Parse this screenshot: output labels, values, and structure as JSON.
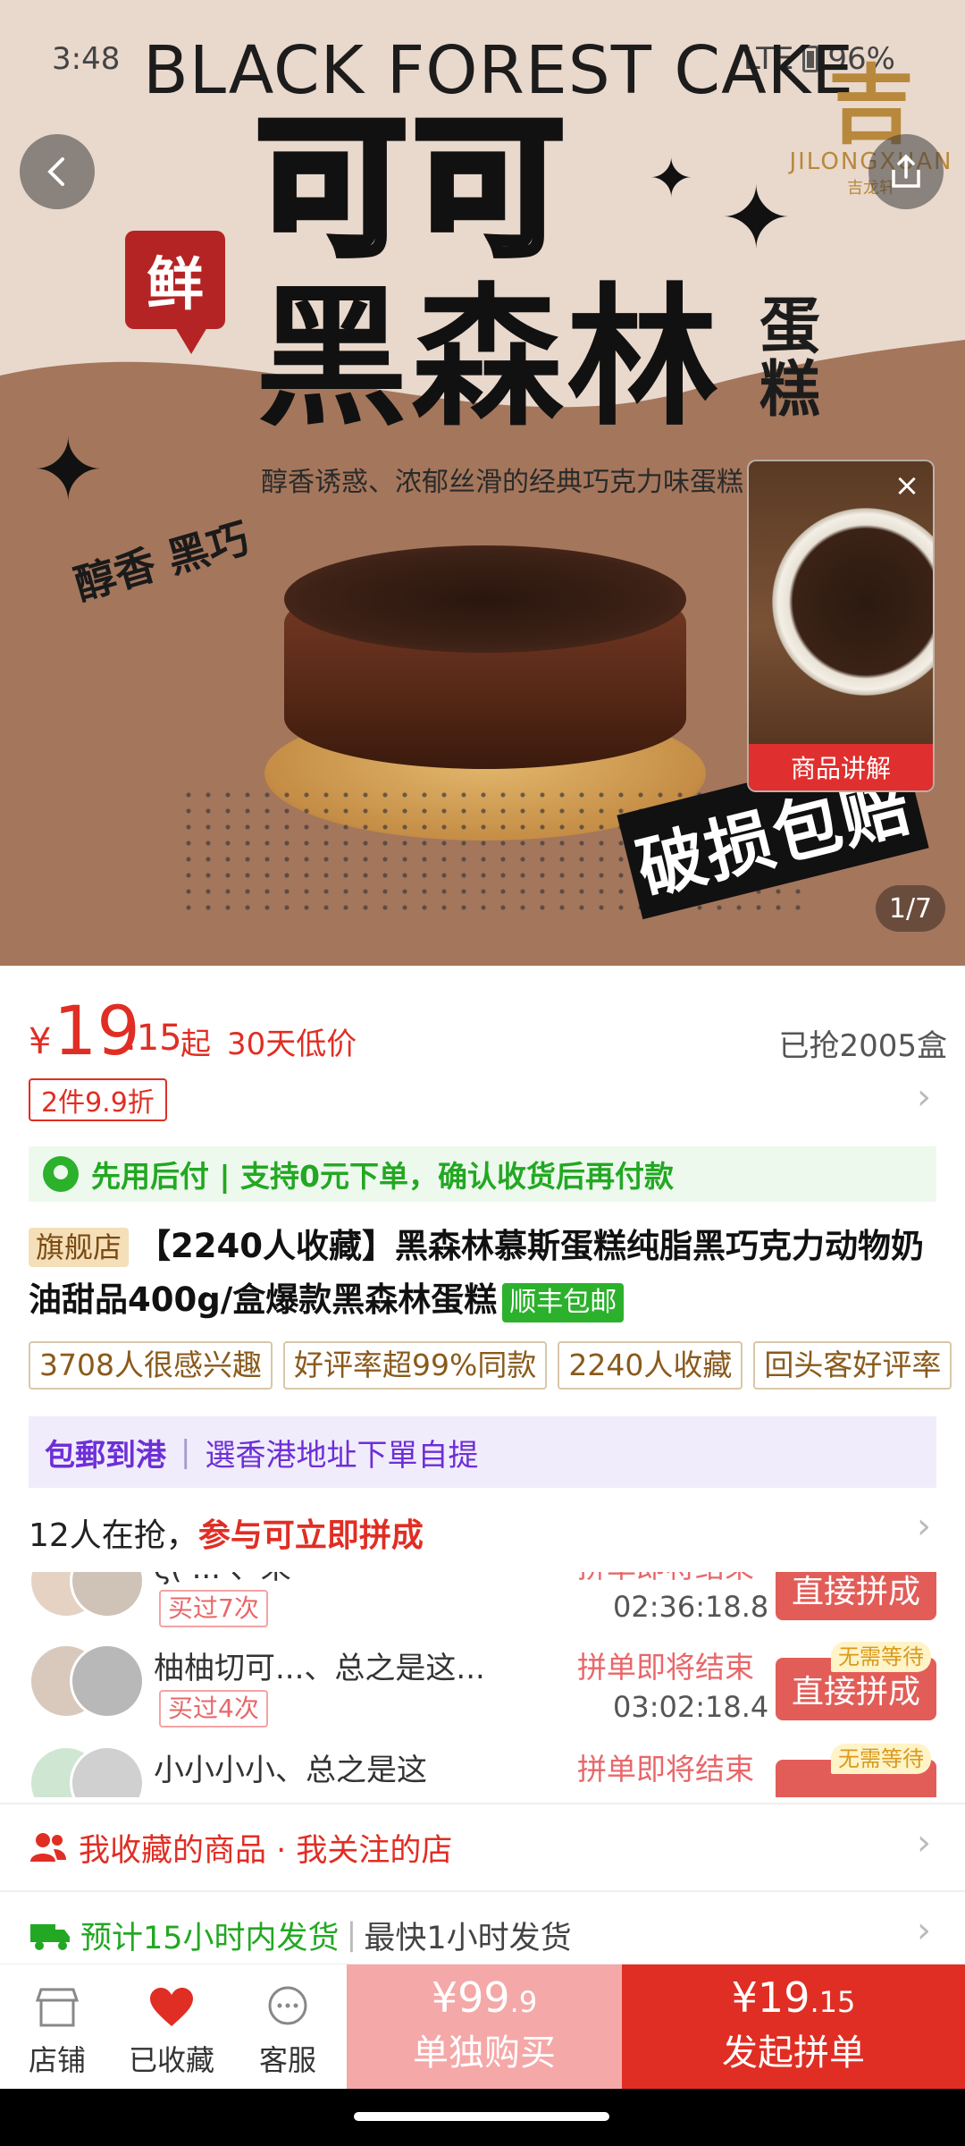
{
  "status": {
    "time": "3:48",
    "network": "LTE",
    "battery": "96%"
  },
  "hero": {
    "title_en": "BLACK FOREST CAKE",
    "title_cn_1": "可可",
    "title_cn_2": "黑森林",
    "title_cn_vertical": "蛋糕",
    "fresh": "鲜",
    "subtitle": "醇香诱惑、浓郁丝滑的经典巧克力味蛋糕",
    "handwriting": "醇香 黑巧",
    "damage_badge": "破损包赔",
    "brand_en": "JILONGXUAN",
    "brand_cn": "吉龙轩",
    "page_indicator": "1/7"
  },
  "mini_video": {
    "label": "商品讲解"
  },
  "price": {
    "symbol": "¥",
    "int": "19",
    "dec": ".15",
    "qi": "起",
    "low_price": "30天低价",
    "sold": "已抢2005盒",
    "discount": "2件9.9折"
  },
  "bnpl": {
    "text": "先用后付 | 支持0元下单，确认收货后再付款"
  },
  "title": {
    "flagship": "旗舰店",
    "text": "【2240人收藏】黑森林慕斯蛋糕纯脂黑巧克力动物奶油甜品400g/盒爆款黑森林蛋糕",
    "sf": "顺丰包邮"
  },
  "chips": [
    "3708人很感兴趣",
    "好评率超99%同款",
    "2240人收藏",
    "回头客好评率"
  ],
  "hk": {
    "strong": "包郵到港",
    "text": "選香港地址下單自提"
  },
  "group": {
    "head_prefix": "12人在抢，",
    "head_red": "参与可立即拼成",
    "rows": [
      {
        "name": "ζ( ... 、来",
        "count": "买过7次",
        "end": "拼单即将结束",
        "timer": "02:36:18.8",
        "join": "直接拼成",
        "nowait": ""
      },
      {
        "name": "柚柚切可...、总之是这...",
        "count": "买过4次",
        "end": "拼单即将结束",
        "timer": "03:02:18.4",
        "join": "直接拼成",
        "nowait": "无需等待"
      },
      {
        "name": "小小小小、总之是这",
        "count": "",
        "end": "拼单即将结束",
        "timer": "",
        "join": "",
        "nowait": "无需等待"
      }
    ]
  },
  "fav_row": {
    "text": "我收藏的商品 · 我关注的店"
  },
  "ship_row": {
    "green": "预计15小时内发货",
    "gray": "最快1小时发货"
  },
  "bottom": {
    "shop": "店铺",
    "favorited": "已收藏",
    "service": "客服",
    "solo_price_symbol": "¥",
    "solo_price_int": "99",
    "solo_price_dec": ".9",
    "solo_label": "单独购买",
    "group_price_symbol": "¥",
    "group_price_int": "19",
    "group_price_dec": ".15",
    "group_label": "发起拼单"
  },
  "colors": {
    "accent": "#e02e24",
    "green": "#22a822",
    "purple": "#6d2fd8"
  }
}
